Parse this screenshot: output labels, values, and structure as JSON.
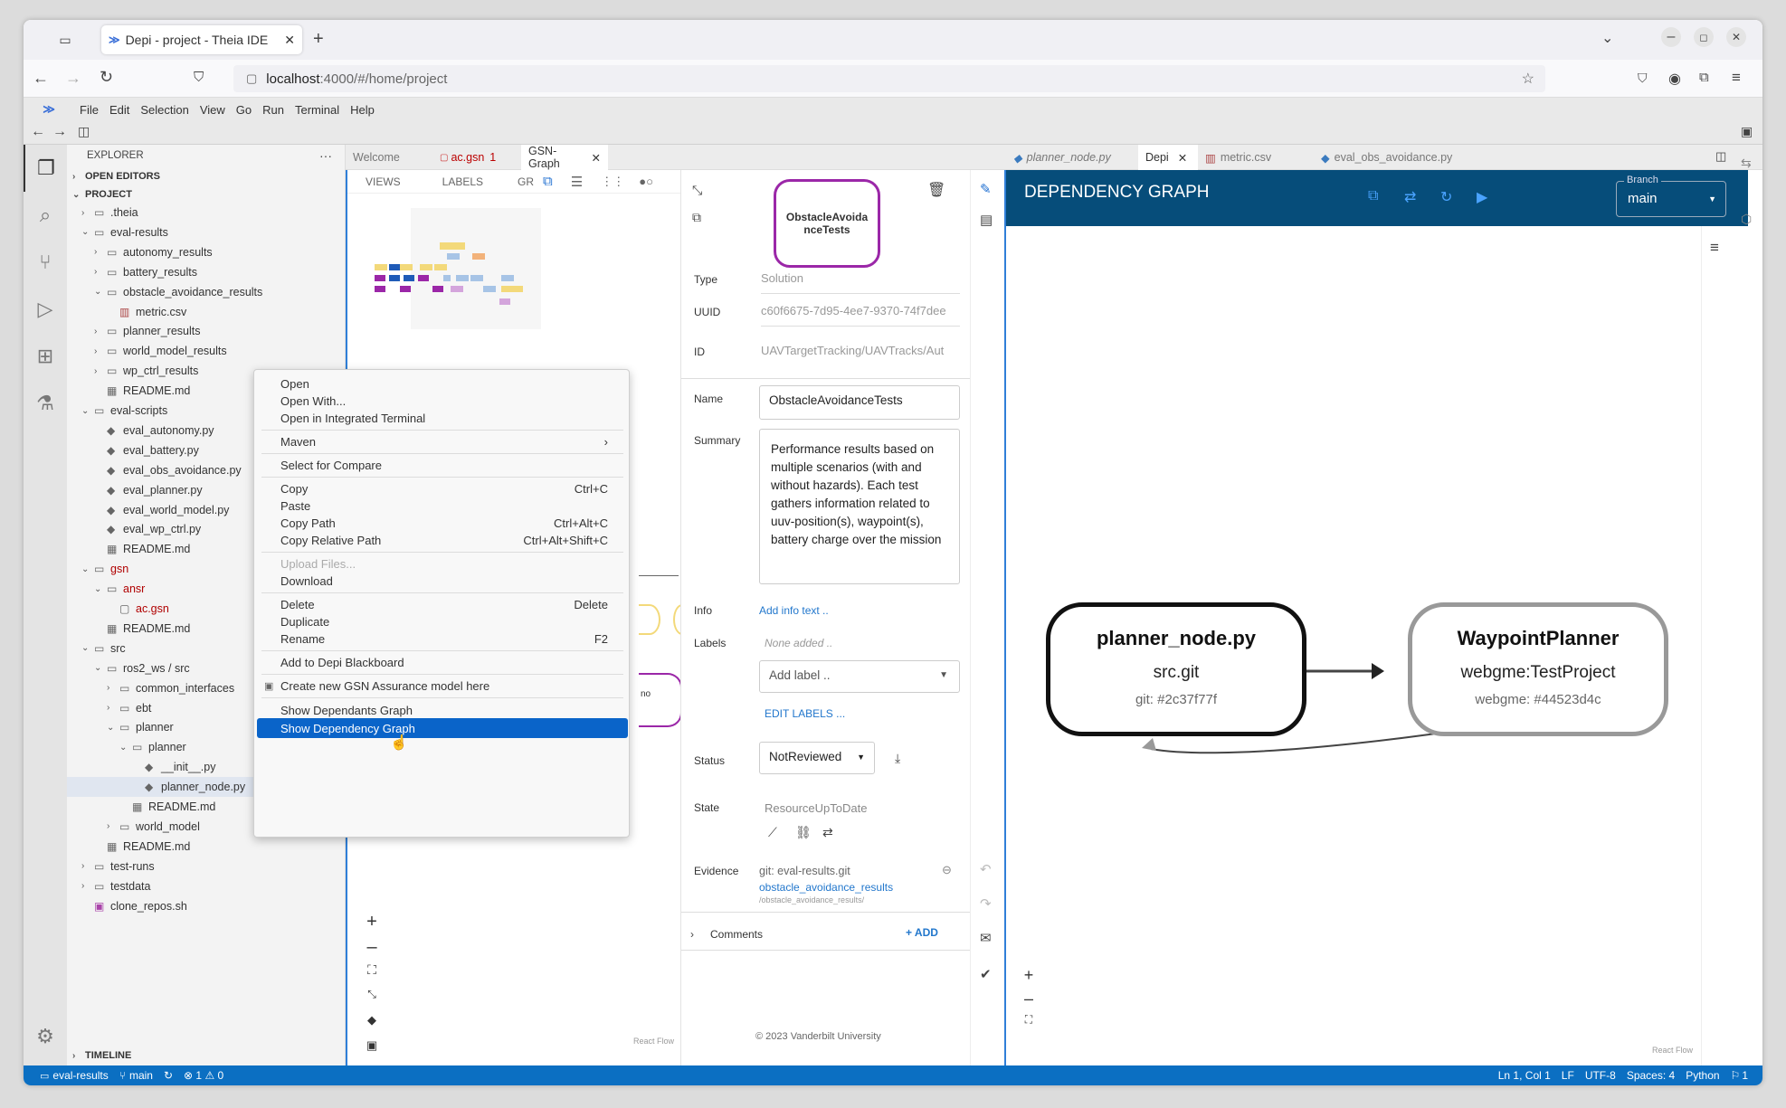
{
  "browser": {
    "tab_title": "Depi - project - Theia IDE",
    "url_host": "localhost",
    "url_path": ":4000/#/home/project"
  },
  "menu": [
    "File",
    "Edit",
    "Selection",
    "View",
    "Go",
    "Run",
    "Terminal",
    "Help"
  ],
  "explorer": {
    "title": "EXPLORER",
    "open_editors": "OPEN EDITORS",
    "project": "PROJECT",
    "timeline": "TIMELINE",
    "tree": [
      {
        "label": ".theia",
        "depth": 0,
        "type": "folder",
        "open": false
      },
      {
        "label": "eval-results",
        "depth": 0,
        "type": "folder",
        "open": true
      },
      {
        "label": "autonomy_results",
        "depth": 1,
        "type": "folder",
        "open": false
      },
      {
        "label": "battery_results",
        "depth": 1,
        "type": "folder",
        "open": false
      },
      {
        "label": "obstacle_avoidance_results",
        "depth": 1,
        "type": "folder",
        "open": true
      },
      {
        "label": "metric.csv",
        "depth": 2,
        "type": "csv"
      },
      {
        "label": "planner_results",
        "depth": 1,
        "type": "folder",
        "open": false
      },
      {
        "label": "world_model_results",
        "depth": 1,
        "type": "folder",
        "open": false
      },
      {
        "label": "wp_ctrl_results",
        "depth": 1,
        "type": "folder",
        "open": false
      },
      {
        "label": "README.md",
        "depth": 1,
        "type": "md"
      },
      {
        "label": "eval-scripts",
        "depth": 0,
        "type": "folder",
        "open": true
      },
      {
        "label": "eval_autonomy.py",
        "depth": 1,
        "type": "py"
      },
      {
        "label": "eval_battery.py",
        "depth": 1,
        "type": "py"
      },
      {
        "label": "eval_obs_avoidance.py",
        "depth": 1,
        "type": "py"
      },
      {
        "label": "eval_planner.py",
        "depth": 1,
        "type": "py"
      },
      {
        "label": "eval_world_model.py",
        "depth": 1,
        "type": "py"
      },
      {
        "label": "eval_wp_ctrl.py",
        "depth": 1,
        "type": "py"
      },
      {
        "label": "README.md",
        "depth": 1,
        "type": "md"
      },
      {
        "label": "gsn",
        "depth": 0,
        "type": "folder",
        "open": true,
        "red": true
      },
      {
        "label": "ansr",
        "depth": 1,
        "type": "folder",
        "open": true,
        "red": true
      },
      {
        "label": "ac.gsn",
        "depth": 2,
        "type": "file",
        "red": true
      },
      {
        "label": "README.md",
        "depth": 1,
        "type": "md"
      },
      {
        "label": "src",
        "depth": 0,
        "type": "folder",
        "open": true
      },
      {
        "label": "ros2_ws / src",
        "depth": 1,
        "type": "folder",
        "open": true
      },
      {
        "label": "common_interfaces",
        "depth": 2,
        "type": "folder",
        "open": false
      },
      {
        "label": "ebt",
        "depth": 2,
        "type": "folder",
        "open": false
      },
      {
        "label": "planner",
        "depth": 2,
        "type": "folder",
        "open": true
      },
      {
        "label": "planner",
        "depth": 3,
        "type": "folder",
        "open": true
      },
      {
        "label": "__init__.py",
        "depth": 4,
        "type": "py"
      },
      {
        "label": "planner_node.py",
        "depth": 4,
        "type": "py",
        "selected": true
      },
      {
        "label": "README.md",
        "depth": 3,
        "type": "md"
      },
      {
        "label": "world_model",
        "depth": 2,
        "type": "folder",
        "open": false
      },
      {
        "label": "README.md",
        "depth": 1,
        "type": "md"
      },
      {
        "label": "test-runs",
        "depth": 0,
        "type": "folder",
        "open": false
      },
      {
        "label": "testdata",
        "depth": 0,
        "type": "folder",
        "open": false
      },
      {
        "label": "clone_repos.sh",
        "depth": 0,
        "type": "sh"
      }
    ]
  },
  "editor_tabs_left": {
    "welcome": "Welcome",
    "acgsn": "ac.gsn",
    "acgsn_badge": "1",
    "gsngraph": "GSN-Graph"
  },
  "editor_tabs_right": {
    "planner": "planner_node.py",
    "depi": "Depi",
    "metric": "metric.csv",
    "evalobs": "eval_obs_avoidance.py"
  },
  "gsn": {
    "tab_views": "VIEWS",
    "tab_labels": "LABELS",
    "tab_gr": "GR",
    "react_flow": "React Flow",
    "node_partial": "no"
  },
  "properties": {
    "node_title": "ObstacleAvoidanceTests",
    "type_label": "Type",
    "type_value": "Solution",
    "uuid_label": "UUID",
    "uuid_value": "c60f6675-7d95-4ee7-9370-74f7dee",
    "id_label": "ID",
    "id_value": "UAVTargetTracking/UAVTracks/Aut",
    "name_label": "Name",
    "name_value": "ObstacleAvoidanceTests",
    "summary_label": "Summary",
    "summary_value": "Performance results based on multiple scenarios (with and without hazards). Each test gathers information related to uuv-position(s), waypoint(s), battery charge over the mission",
    "info_label": "Info",
    "info_link": "Add info text ..",
    "labels_label": "Labels",
    "labels_none": "None added ..",
    "add_label": "Add label ..",
    "edit_labels": "EDIT LABELS ...",
    "status_label": "Status",
    "status_value": "NotReviewed",
    "state_label": "State",
    "state_value": "ResourceUpToDate",
    "evidence_label": "Evidence",
    "evidence_repo": "git: eval-results.git",
    "evidence_link": "obstacle_avoidance_results",
    "evidence_path": "/obstacle_avoidance_results/",
    "comments_label": "Comments",
    "add_comment": "+ ADD",
    "copyright": "© 2023 Vanderbilt University"
  },
  "depi": {
    "title": "DEPENDENCY GRAPH",
    "branch_label": "Branch",
    "branch_value": "main",
    "react_flow": "React Flow",
    "nodes": [
      {
        "title": "planner_node.py",
        "repo": "src.git",
        "version": "git: #2c37f77f"
      },
      {
        "title": "WaypointPlanner",
        "repo": "webgme:TestProject",
        "version": "webgme: #44523d4c"
      }
    ]
  },
  "context_menu": {
    "open": "Open",
    "open_with": "Open With...",
    "open_terminal": "Open in Integrated Terminal",
    "maven": "Maven",
    "select_compare": "Select for Compare",
    "copy": "Copy",
    "copy_key": "Ctrl+C",
    "paste": "Paste",
    "copy_path": "Copy Path",
    "copy_path_key": "Ctrl+Alt+C",
    "copy_rel": "Copy Relative Path",
    "copy_rel_key": "Ctrl+Alt+Shift+C",
    "upload": "Upload Files...",
    "download": "Download",
    "delete": "Delete",
    "delete_key": "Delete",
    "duplicate": "Duplicate",
    "rename": "Rename",
    "rename_key": "F2",
    "add_depi": "Add to Depi Blackboard",
    "create_gsn": "Create new GSN Assurance model here",
    "show_dependants": "Show Dependants Graph",
    "show_dependency": "Show Dependency Graph"
  },
  "statusbar": {
    "repo": "eval-results",
    "branch": "main",
    "problems": "⊗ 1 ⚠ 0",
    "position": "Ln 1, Col 1",
    "eol": "LF",
    "encoding": "UTF-8",
    "spaces": "Spaces: 4",
    "language": "Python",
    "notif": "1"
  },
  "colors": {
    "accent": "#0b6fc2",
    "depi_header": "#064d7a",
    "gsn_node_border": "#9b27a8",
    "menu_highlight": "#0a64c9"
  }
}
